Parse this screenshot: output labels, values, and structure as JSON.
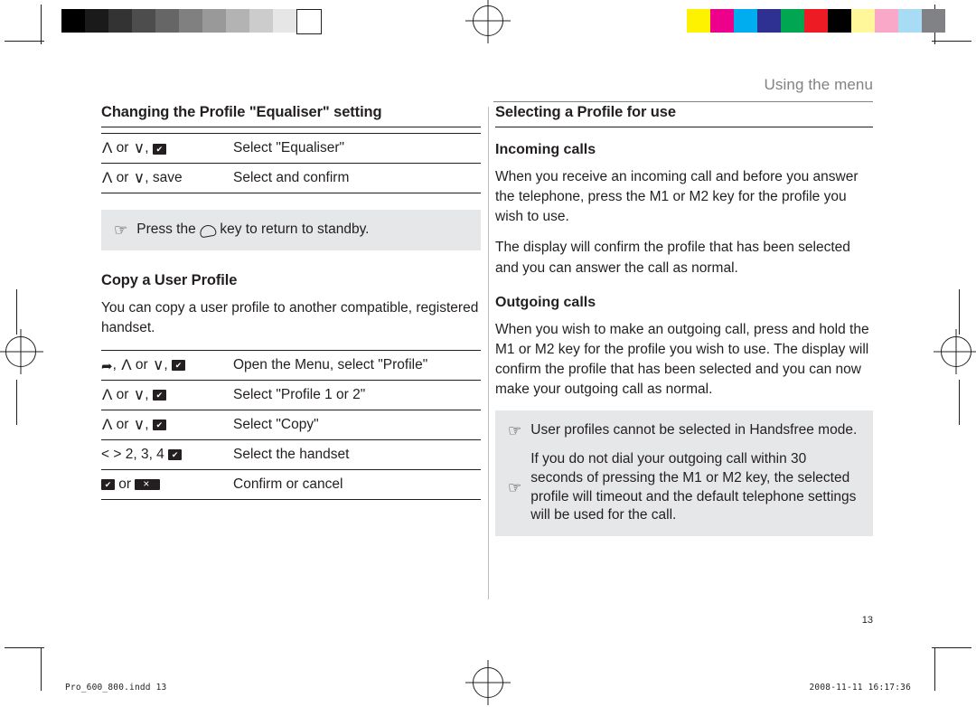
{
  "page": {
    "running_head": "Using the menu",
    "folio": "13",
    "footer_left": "Pro_600_800.indd   13",
    "footer_right": "2008-11-11   16:17:36"
  },
  "printbars": {
    "grayscale": [
      "#000000",
      "#1a1a1a",
      "#333333",
      "#4d4d4d",
      "#666666",
      "#808080",
      "#999999",
      "#b3b3b3",
      "#cccccc",
      "#e6e6e6",
      "#ffffff"
    ],
    "color": [
      "#fff200",
      "#ec008c",
      "#00aeef",
      "#2e3192",
      "#00a651",
      "#ed1c24",
      "#000000",
      "#fff799",
      "#f9a8c8",
      "#a7dcf4",
      "#808285"
    ]
  },
  "left_column": {
    "heading": "Changing the Profile \"Equaliser\" setting",
    "table1": [
      {
        "keys": [
          {
            "type": "up"
          },
          {
            "type": "text",
            "value": " or "
          },
          {
            "type": "down"
          },
          {
            "type": "text",
            "value": ", "
          },
          {
            "type": "ok"
          }
        ],
        "action": "Select \"Equaliser\""
      },
      {
        "keys": [
          {
            "type": "up"
          },
          {
            "type": "text",
            "value": " or "
          },
          {
            "type": "down"
          },
          {
            "type": "text",
            "value": ", save"
          }
        ],
        "action": "Select and confirm"
      }
    ],
    "note": "Press the       key to return to standby.",
    "note_prefix": "Press the",
    "note_suffix": "key to return to standby.",
    "heading2": "Copy a User Profile",
    "paragraph": "You can copy a user profile to another compatible, registered handset.",
    "table2": [
      {
        "keys": [
          {
            "type": "menu"
          },
          {
            "type": "text",
            "value": ", "
          },
          {
            "type": "up"
          },
          {
            "type": "text",
            "value": " or "
          },
          {
            "type": "down"
          },
          {
            "type": "text",
            "value": ", "
          },
          {
            "type": "ok"
          }
        ],
        "action": "Open the Menu, select \"Profile\""
      },
      {
        "keys": [
          {
            "type": "up"
          },
          {
            "type": "text",
            "value": " or "
          },
          {
            "type": "down"
          },
          {
            "type": "text",
            "value": ", "
          },
          {
            "type": "ok"
          }
        ],
        "action": "Select \"Profile 1 or 2\""
      },
      {
        "keys": [
          {
            "type": "up"
          },
          {
            "type": "text",
            "value": " or "
          },
          {
            "type": "down"
          },
          {
            "type": "text",
            "value": ", "
          },
          {
            "type": "ok"
          }
        ],
        "action": "Select \"Copy\""
      },
      {
        "keys": [
          {
            "type": "text",
            "value": "< > 2, 3, 4 "
          },
          {
            "type": "ok"
          }
        ],
        "action": "Select the handset"
      },
      {
        "keys": [
          {
            "type": "ok"
          },
          {
            "type": "text",
            "value": " or "
          },
          {
            "type": "esc"
          }
        ],
        "action": "Confirm or cancel"
      }
    ]
  },
  "right_column": {
    "heading": "Selecting a Profile for use",
    "sub1": "Incoming calls",
    "p1": "When you receive an incoming call and before you answer the telephone, press the M1 or M2 key for the profile you wish to use.",
    "p2": "The display will confirm the profile that has been selected and you can answer the call as normal.",
    "sub2": "Outgoing calls",
    "p3": "When you wish to make an outgoing call, press and hold the M1 or M2 key for the profile you wish to use. The display will confirm the profile that has been selected and you can now make your outgoing call as normal.",
    "note1": "User profiles cannot be selected in Handsfree mode.",
    "note2": "If you do not dial your outgoing call within 30 seconds of pressing the M1 or M2 key, the selected profile will timeout and the default telephone settings will be used for the call."
  },
  "icons": {
    "hand": "☞",
    "up": "Λ",
    "down": "∨",
    "menu": "➦"
  }
}
